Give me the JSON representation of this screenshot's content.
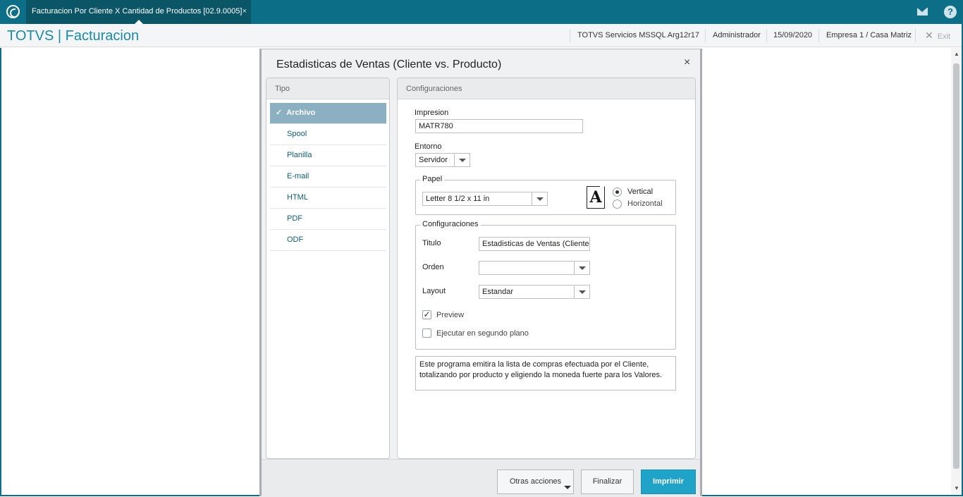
{
  "tab": {
    "title": "Facturacion Por Cliente X Cantidad de Productos [02.9.0005]",
    "close": "×"
  },
  "header": {
    "app_title": "TOTVS | Facturacion",
    "server": "TOTVS Servicios MSSQL Arg12r17",
    "user": "Administrador",
    "date": "15/09/2020",
    "company": "Empresa 1 / Casa Matriz",
    "exit_label": "Exit"
  },
  "dialog": {
    "title": "Estadisticas de Ventas (Cliente vs. Producto)",
    "close": "×",
    "tipo_header": "Tipo",
    "tipo_items": [
      "Archivo",
      "Spool",
      "Planilla",
      "E-mail",
      "HTML",
      "PDF",
      "ODF"
    ],
    "tipo_selected": "Archivo",
    "config_header": "Configuraciones",
    "impresion_label": "Impresion",
    "impresion_value": "MATR780",
    "entorno_label": "Entorno",
    "entorno_value": "Servidor",
    "papel_label": "Papel",
    "papel_value": "Letter 8 1/2 x 11 in",
    "paper_icon_letter": "A",
    "orientation_vertical": "Vertical",
    "orientation_horizontal": "Horizontal",
    "orientation_selected": "Vertical",
    "config_group_label": "Configuraciones",
    "titulo_label": "Titulo",
    "titulo_value": "Estadisticas de Ventas (Cliente",
    "orden_label": "Orden",
    "orden_value": "",
    "layout_label": "Layout",
    "layout_value": "Estandar",
    "preview_label": "Preview",
    "preview_checked": true,
    "segundo_plano_label": "Ejecutar en segundo plano",
    "segundo_plano_checked": false,
    "description": "Este programa emitira la lista de compras efectuada por el Cliente, totalizando por producto y eligiendo la moneda fuerte para los Valores.",
    "btn_otras": "Otras acciones",
    "btn_finalizar": "Finalizar",
    "btn_imprimir": "Imprimir"
  },
  "colors": {
    "brand": "#0d6e87",
    "accent": "#1fa3c9",
    "selected": "#8bb0c1"
  },
  "icons": {
    "logo": "totvs-logo-icon",
    "mail": "mail-icon",
    "help": "help-icon",
    "check": "✓"
  }
}
